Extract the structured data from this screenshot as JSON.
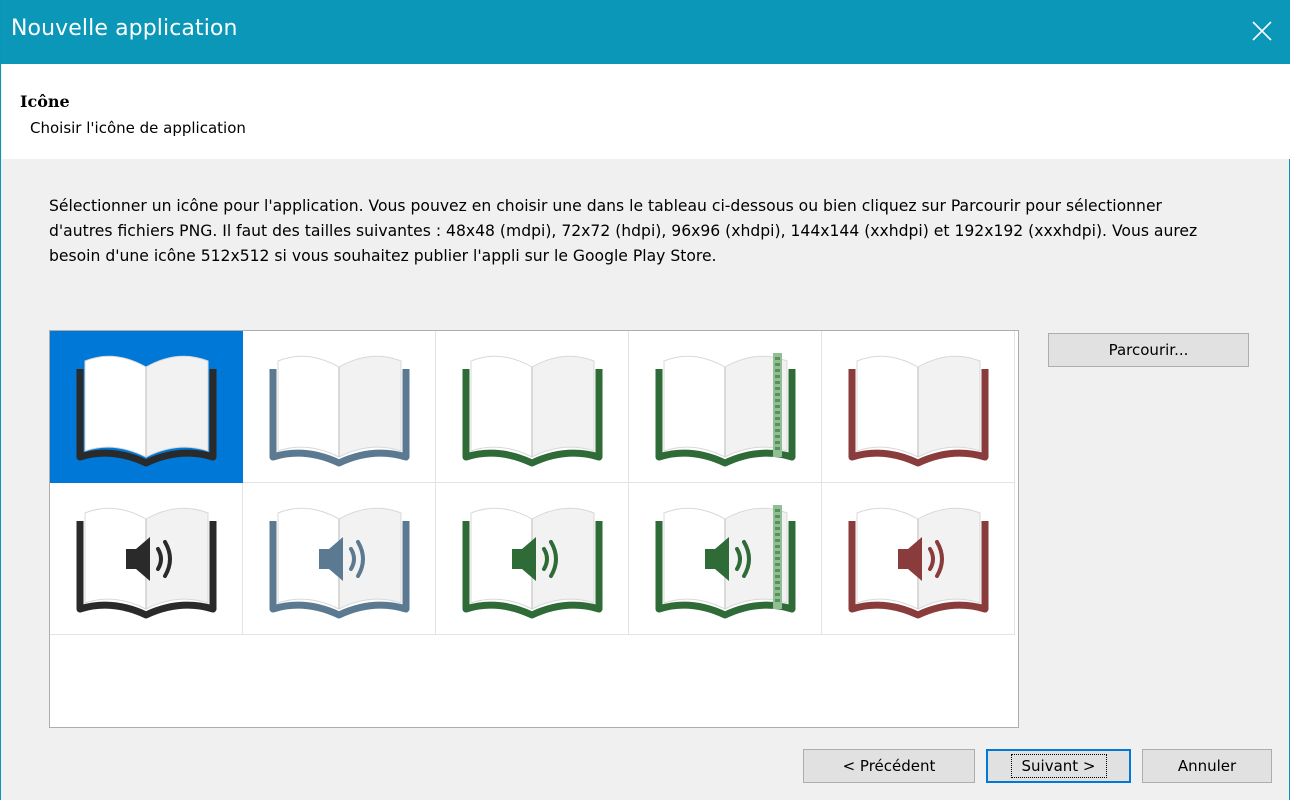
{
  "window": {
    "title": "Nouvelle application"
  },
  "header": {
    "title": "Icône",
    "subtitle": "Choisir l'icône de application"
  },
  "description": "Sélectionner un icône pour l'application. Vous pouvez en choisir une dans le tableau ci-dessous ou bien cliquez sur Parcourir pour sélectionner d'autres fichiers PNG. Il faut des tailles suivantes : 48x48 (mdpi), 72x72 (hdpi), 96x96 (xhdpi), 144x144 (xxhdpi) et 192x192 (xxxhdpi). Vous aurez besoin d'une icône 512x512 si vous souhaitez publier l'appli sur le Google Play Store.",
  "buttons": {
    "browse": "Parcourir...",
    "previous": "< Précédent",
    "next": "Suivant >",
    "cancel": "Annuler"
  },
  "icons": [
    {
      "name": "book-icon",
      "color": "#2a2a2a",
      "speaker": false,
      "ribbon": false,
      "selected": true
    },
    {
      "name": "book-icon",
      "color": "#5b7a91",
      "speaker": false,
      "ribbon": false,
      "selected": false
    },
    {
      "name": "book-icon",
      "color": "#2e6b36",
      "speaker": false,
      "ribbon": false,
      "selected": false
    },
    {
      "name": "book-icon",
      "color": "#2e6b36",
      "speaker": false,
      "ribbon": true,
      "selected": false
    },
    {
      "name": "book-icon",
      "color": "#8a3b3b",
      "speaker": false,
      "ribbon": false,
      "selected": false
    },
    {
      "name": "audio-book-icon",
      "color": "#2a2a2a",
      "speaker": true,
      "ribbon": false,
      "selected": false
    },
    {
      "name": "audio-book-icon",
      "color": "#5b7a91",
      "speaker": true,
      "ribbon": false,
      "selected": false
    },
    {
      "name": "audio-book-icon",
      "color": "#2e6b36",
      "speaker": true,
      "ribbon": false,
      "selected": false
    },
    {
      "name": "audio-book-icon",
      "color": "#2e6b36",
      "speaker": true,
      "ribbon": true,
      "selected": false
    },
    {
      "name": "audio-book-icon",
      "color": "#8a3b3b",
      "speaker": true,
      "ribbon": false,
      "selected": false
    }
  ]
}
